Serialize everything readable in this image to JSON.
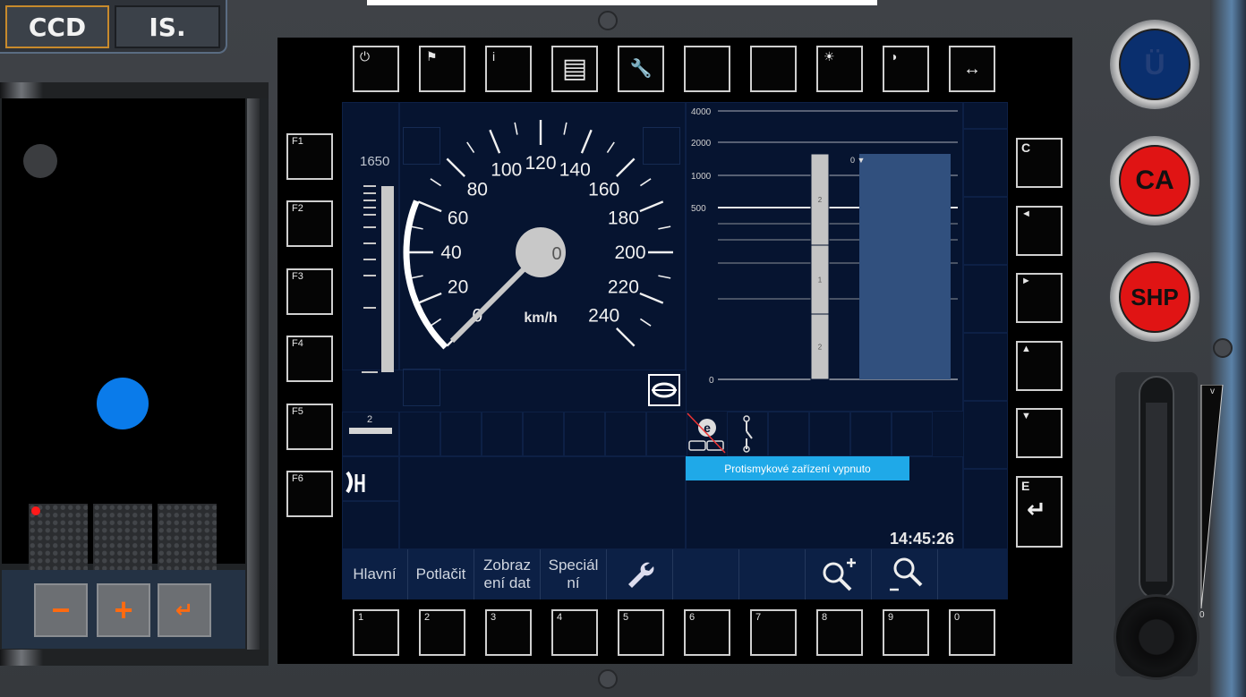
{
  "top_tabs": {
    "ccd": "CCD",
    "is": "IS."
  },
  "left_panel": {
    "minus": "−",
    "plus": "+",
    "enter": "↵"
  },
  "top_softkeys": [
    "power-icon",
    "flag-icon",
    "info-icon",
    "document-icon",
    "wrench-icon",
    "blank",
    "blank",
    "brightness-icon",
    "contrast-icon",
    "arrows-horizontal-icon"
  ],
  "f_keys": [
    "F1",
    "F2",
    "F3",
    "F4",
    "F5",
    "F6"
  ],
  "right_keys": [
    {
      "label": "C"
    },
    {
      "label": "◄"
    },
    {
      "label": "►"
    },
    {
      "label": "▲"
    },
    {
      "label": "▼"
    },
    {
      "label": "E"
    }
  ],
  "bottom_keys": [
    "1",
    "2",
    "3",
    "4",
    "5",
    "6",
    "7",
    "8",
    "9",
    "0"
  ],
  "speedometer": {
    "unit": "km/h",
    "current_speed": "0",
    "ticks": [
      "0",
      "20",
      "40",
      "60",
      "80",
      "100",
      "120",
      "140",
      "160",
      "180",
      "200",
      "220",
      "240"
    ]
  },
  "distance_bar": {
    "top_label": "1650",
    "level_fraction": 1.0
  },
  "gradient_marker": "2",
  "planning": {
    "scale": [
      "4000",
      "2000",
      "1000",
      "500",
      "0"
    ],
    "gradient_segments": [
      "2",
      "1",
      "2"
    ],
    "speed_marker": "0"
  },
  "info_message": "Protismykové zařízení vypnuto",
  "clock": "14:45:26",
  "menu": [
    "Hlavní",
    "Potlačit",
    "Zobraz ení dat",
    "Speciál ní"
  ],
  "colors": {
    "screen": "#061430",
    "menu": "#0c2045",
    "message": "#1fa9e8",
    "ca_button": "#e01414",
    "ueb_button": "#0a2f6e",
    "led_red": "#ff1a1a",
    "indicator_blue": "#0a7bea"
  },
  "round_buttons": {
    "u": "Ü",
    "ca": "CA",
    "shp": "SHP"
  },
  "throttle": {
    "top_label": "v",
    "bottom_label": "0"
  }
}
